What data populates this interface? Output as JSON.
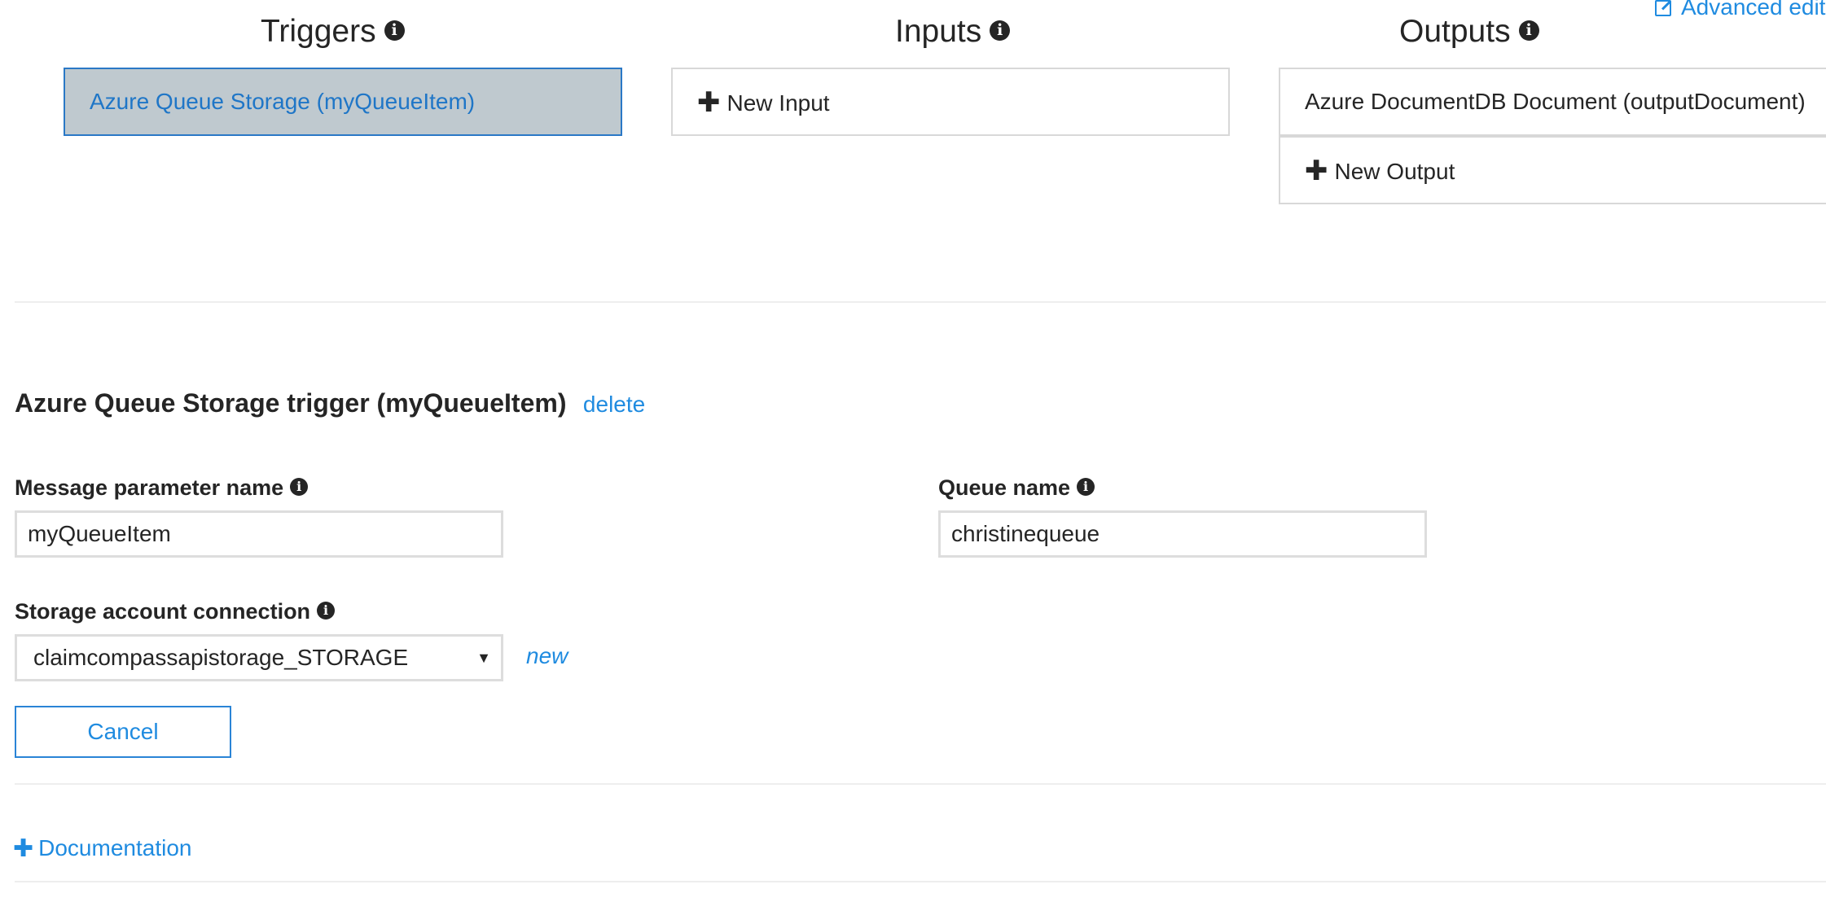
{
  "header": {
    "advanced_editor_label": "Advanced edit"
  },
  "columns": {
    "triggers": {
      "title": "Triggers",
      "items": [
        "Azure Queue Storage (myQueueItem)"
      ]
    },
    "inputs": {
      "title": "Inputs",
      "new_label": "New Input"
    },
    "outputs": {
      "title": "Outputs",
      "items": [
        "Azure DocumentDB Document (outputDocument)"
      ],
      "new_label": "New Output"
    }
  },
  "trigger_details": {
    "title": "Azure Queue Storage trigger (myQueueItem)",
    "delete_label": "delete",
    "message_param": {
      "label": "Message parameter name",
      "value": "myQueueItem"
    },
    "queue_name": {
      "label": "Queue name",
      "value": "christinequeue"
    },
    "storage_connection": {
      "label": "Storage account connection",
      "value": "claimcompassapistorage_STORAGE",
      "new_label": "new"
    },
    "cancel_label": "Cancel"
  },
  "documentation": {
    "label": "Documentation"
  },
  "icons": {
    "info": "info-circle-icon",
    "plus": "plus-icon",
    "edit": "edit-icon",
    "dropdown": "caret-down-icon"
  },
  "colors": {
    "accent": "#1f8be0",
    "selected_bg": "#bfc9cf",
    "selected_border": "#2a78c6",
    "text": "#252525",
    "border": "#d8d8d8"
  }
}
